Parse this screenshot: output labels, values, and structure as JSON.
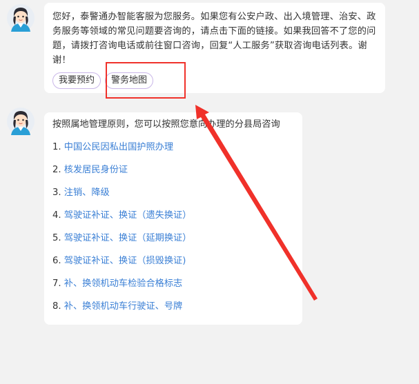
{
  "messages": {
    "first": {
      "text": "您好，泰警通办智能客服为您服务。如果您有公安户政、出入境管理、治安、政务服务等领域的常见问题要咨询的，请点击下面的链接。如果我回答不了您的问题，请拨打咨询电话或前往窗口咨询，回复“人工服务”获取咨询电话列表。谢谢！",
      "quick_buttons": [
        "我要预约",
        "警务地图"
      ]
    },
    "second": {
      "intro": "按照属地管理原则，您可以按照您意向办理的分县局咨询",
      "items": [
        {
          "num": "1.",
          "label": "中国公民因私出国护照办理"
        },
        {
          "num": "2.",
          "label": "核发居民身份证"
        },
        {
          "num": "3.",
          "label": "注销、降级"
        },
        {
          "num": "4.",
          "label": "驾驶证补证、换证（遗失换证）"
        },
        {
          "num": "5.",
          "label": "驾驶证补证、换证（延期换证）"
        },
        {
          "num": "6.",
          "label": "驾驶证补证、换证（损毁换证)"
        },
        {
          "num": "7.",
          "label": "补、换领机动车检验合格标志"
        },
        {
          "num": "8.",
          "label": "补、换领机动车行驶证、号牌"
        }
      ]
    }
  },
  "colors": {
    "link": "#3a7fd5",
    "annotation": "#f0312a",
    "chip_border": "#c9b6e8",
    "background": "#f2f2f2"
  },
  "icons": [
    "assistant-avatar-icon",
    "annotation-arrow"
  ]
}
